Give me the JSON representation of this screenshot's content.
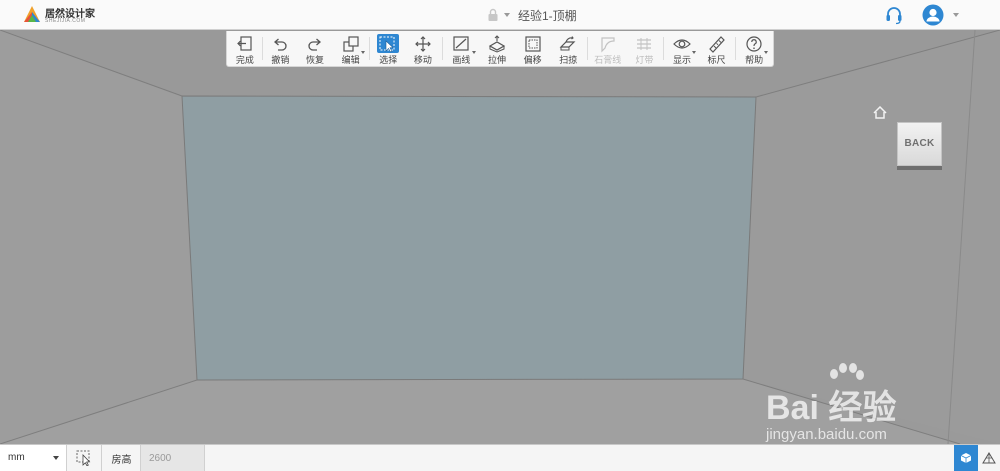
{
  "app": {
    "logo_name": "居然设计家",
    "logo_sub": "SHEJIJIA.COM",
    "doc_title": "经验1-顶棚"
  },
  "toolbar": {
    "items": [
      {
        "label": "完成",
        "icon": "exit-icon",
        "enabled": true
      },
      {
        "label": "撤销",
        "icon": "undo-icon",
        "enabled": true
      },
      {
        "label": "恢复",
        "icon": "redo-icon",
        "enabled": true
      },
      {
        "label": "编辑",
        "icon": "edit-copy-icon",
        "enabled": true,
        "dropdown": true
      },
      {
        "label": "选择",
        "icon": "select-cursor-icon",
        "enabled": true,
        "active": true
      },
      {
        "label": "移动",
        "icon": "move-arrows-icon",
        "enabled": true
      },
      {
        "label": "画线",
        "icon": "draw-line-icon",
        "enabled": true,
        "dropdown": true
      },
      {
        "label": "拉伸",
        "icon": "extrude-icon",
        "enabled": true
      },
      {
        "label": "偏移",
        "icon": "offset-icon",
        "enabled": true
      },
      {
        "label": "扫掠",
        "icon": "sweep-icon",
        "enabled": true
      },
      {
        "label": "石膏线",
        "icon": "molding-icon",
        "enabled": false
      },
      {
        "label": "灯带",
        "icon": "light-strip-icon",
        "enabled": false
      },
      {
        "label": "显示",
        "icon": "eye-icon",
        "enabled": true,
        "dropdown": true
      },
      {
        "label": "标尺",
        "icon": "ruler-icon",
        "enabled": true
      },
      {
        "label": "帮助",
        "icon": "help-icon",
        "enabled": true,
        "dropdown": true
      }
    ]
  },
  "scene": {
    "back_label": "BACK",
    "ceiling_color": "#8f9ea3",
    "wall_color": "#9a9a9a"
  },
  "watermark": {
    "text": "Bai 经验",
    "sub": "jingyan.baidu.com"
  },
  "bottom": {
    "unit": "mm",
    "height_label": "房高",
    "height_value": "2600"
  },
  "colors": {
    "accent": "#2e87d2"
  }
}
